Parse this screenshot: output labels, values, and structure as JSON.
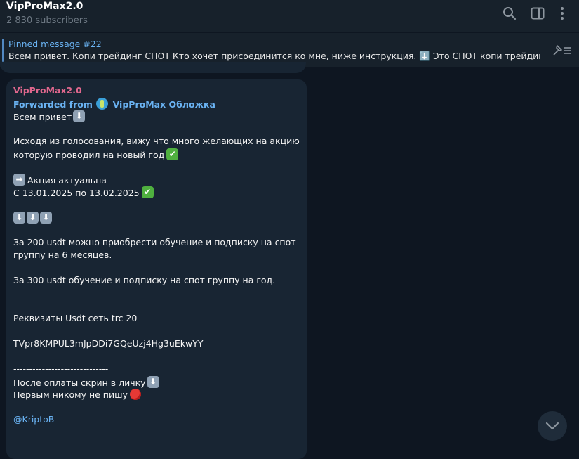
{
  "header": {
    "title": "VipProMax2.0",
    "subscribers": "2 830 subscribers",
    "icons": [
      "search-icon",
      "sidebar-toggle-icon",
      "more-icon"
    ]
  },
  "pinned": {
    "title": "Pinned message #22",
    "text": "Всем привет. Копи трейдинг СПОТ Кто хочет присоединится ко мне, ниже инструкция. ⬇️ Это СПОТ копи трейдинг ( Н..."
  },
  "message": {
    "sender": "VipProMax2.0",
    "forwarded_label": "Forwarded from",
    "forwarded_source": "VipProMax Обложка",
    "greeting": "Всем привет",
    "vote_line1": "Исходя из голосования, вижу что много желающих на акцию",
    "vote_line2": "которую проводил на новый год",
    "promo_actual": "Акция актуальна",
    "promo_dates": " С 13.01.2025 по 13.02.2025",
    "offer_200_line1": "За 200 usdt можно приобрести обучение и подписку на спот",
    "offer_200_line2": "группу на 6 месяцев.",
    "offer_300": "За 300 usdt обучение и подписку на спот группу на год.",
    "divider1": "--------------------------",
    "requisites": "Реквизиты Usdt сеть trc 20",
    "wallet": "TVpr8KMPUL3mJpDDi7GQeUzj4Hg3uEkwYY",
    "divider2": "------------------------------",
    "after_payment": "После оплаты скрин в личку",
    "no_first": "Первым никому не пишу",
    "contact": "@KriptoB"
  },
  "colors": {
    "background": "#0e1621",
    "panel": "#17212b",
    "bubble": "#182533",
    "accent": "#6ab3f3",
    "sender": "#e0678d"
  }
}
